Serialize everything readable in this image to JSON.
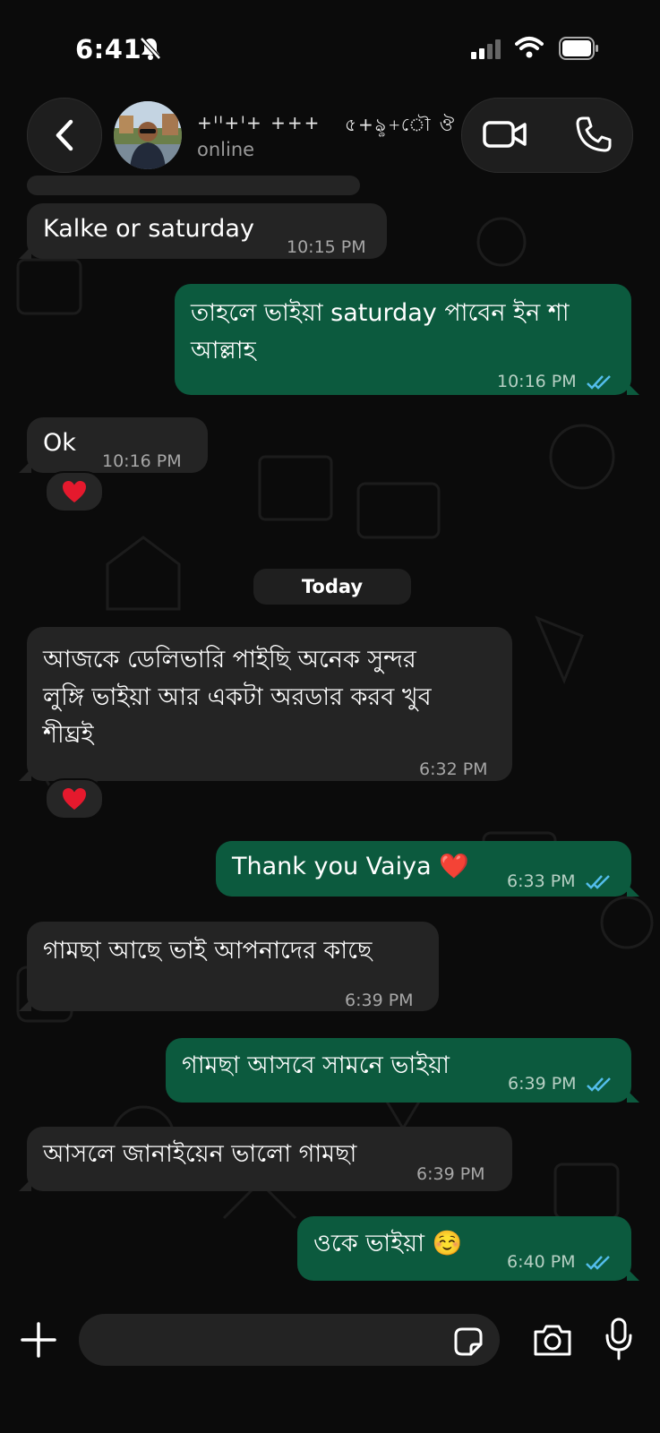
{
  "status_bar": {
    "time": "6:41"
  },
  "header": {
    "contact_name_part1": "+ᑊᑊ+ᑊ+ +++",
    "contact_name_part2": "৫+ৡ+ৌ ঔ",
    "contact_status": "online",
    "icons": [
      "back-chevron-icon",
      "video-call-icon",
      "phone-icon"
    ]
  },
  "messages": [
    {
      "dir": "in",
      "text": "Kalke or saturday",
      "time": "10:15 PM"
    },
    {
      "dir": "out",
      "text": "তাহলে ভাইয়া saturday পাবেন ইন শা\nআল্লাহ",
      "time": "10:16 PM",
      "read": true
    },
    {
      "dir": "in",
      "text": "Ok",
      "time": "10:16 PM",
      "reaction": "❤️"
    },
    {
      "dir": "in",
      "text": "আজকে ডেলিভারি পাইছি অনেক সুন্দর\nলুঙ্গি ভাইয়া আর একটা অরডার করব খুব\nশীঘ্রই",
      "time": "6:32 PM",
      "reaction": "❤️"
    },
    {
      "dir": "out",
      "text": "Thank you Vaiya ❤️",
      "time": "6:33 PM",
      "read": true
    },
    {
      "dir": "in",
      "text": "গামছা আছে ভাই আপনাদের কাছে",
      "time": "6:39 PM"
    },
    {
      "dir": "out",
      "text": "গামছা আসবে সামনে ভাইয়া",
      "time": "6:39 PM",
      "read": true
    },
    {
      "dir": "in",
      "text": "আসলে জানাইয়েন ভালো গামছা",
      "time": "6:39 PM"
    },
    {
      "dir": "out",
      "text": "ওকে ভাইয়া ☺️",
      "time": "6:40 PM",
      "read": true
    }
  ],
  "date_separator": "Today",
  "composer": {
    "placeholder": "",
    "icons": [
      "plus-icon",
      "sticker-icon",
      "camera-icon",
      "microphone-icon"
    ]
  },
  "colors": {
    "background": "#0b0b0b",
    "incoming_bubble": "#242424",
    "outgoing_bubble": "#0c5a3e",
    "read_ticks": "#53bdeb"
  }
}
